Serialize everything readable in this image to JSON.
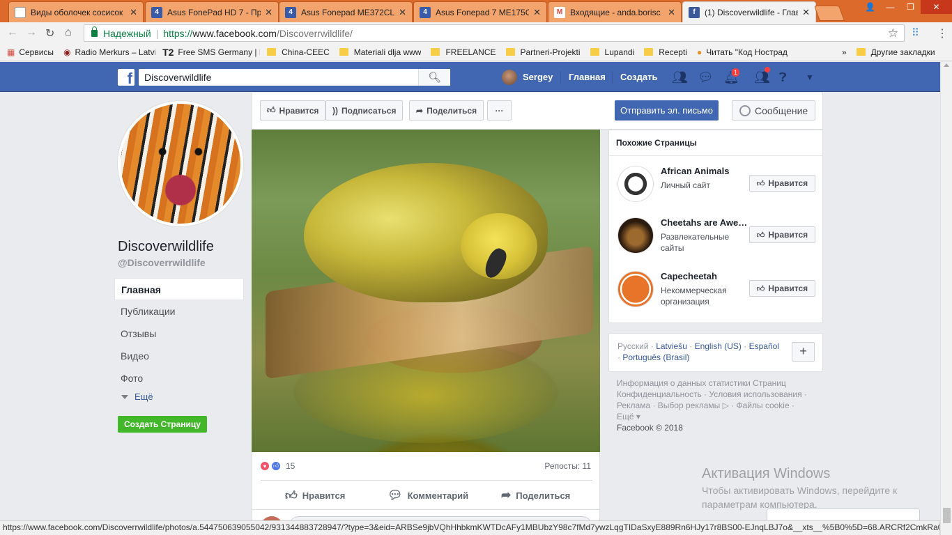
{
  "browser": {
    "tabs": [
      {
        "label": "Виды оболочек сосисок",
        "fav": "doc"
      },
      {
        "label": "Asus FonePad HD 7 - Пр",
        "fav": "4pda"
      },
      {
        "label": "Asus Fonepad ME372CL",
        "fav": "4pda"
      },
      {
        "label": "Asus Fonepad 7 ME175C",
        "fav": "4pda"
      },
      {
        "label": "Входящие - anda.borisc",
        "fav": "gmail"
      },
      {
        "label": "(1) Discoverwildlife - Глав",
        "fav": "facebook"
      }
    ],
    "secure_label": "Надежный",
    "url_proto": "https://",
    "url_host": "www.facebook.com",
    "url_path": "/Discoverrwildlife/",
    "bookmarks": [
      {
        "label": "Сервисы",
        "icon": "apps-icon"
      },
      {
        "label": "Radio Merkurs – Latvi",
        "icon": "radio-icon"
      },
      {
        "label": "Free SMS Germany | F",
        "icon": "t2-icon"
      },
      {
        "label": "China-CEEC",
        "icon": "folder-icon"
      },
      {
        "label": "Materiali dlja www",
        "icon": "folder-icon"
      },
      {
        "label": "FREELANCE",
        "icon": "folder-icon"
      },
      {
        "label": "Partneri-Projekti",
        "icon": "folder-icon"
      },
      {
        "label": "Lupandi",
        "icon": "folder-icon"
      },
      {
        "label": "Recepti",
        "icon": "folder-icon"
      },
      {
        "label": "Читать \"Код Нострад",
        "icon": "book-icon"
      }
    ],
    "bookmarks_more": "»",
    "other_bookmarks": "Другие закладки",
    "status_url": "https://www.facebook.com/Discoverrwildlife/photos/a.544750639055042/931344883728947/?type=3&eid=ARBSe9jbVQhHhbkmKWTDcAFy1MBUbzY98c7fMd7ywzLqgTIDaSxyE889Rn6HJy17r8BS00-EJnqLBJ7o&__xts__%5B0%5D=68.ARCRf2CmkRa0rpUI..."
  },
  "fb_header": {
    "search_value": "Discoverwildlife",
    "user_name": "Sergey",
    "home_label": "Главная",
    "create_label": "Создать",
    "notification_count": "1"
  },
  "page": {
    "name": "Discoverwildlife",
    "handle": "@Discoverrwildlife",
    "nav": [
      "Главная",
      "Публикации",
      "Отзывы",
      "Видео",
      "Фото"
    ],
    "more_label": "Ещё",
    "create_page_label": "Создать Страницу"
  },
  "actions": {
    "like": "Нравится",
    "follow": "Подписаться",
    "share": "Поделиться",
    "more": "···",
    "email": "Отправить эл. письмо",
    "message": "Сообщение"
  },
  "post": {
    "reactions_count": "15",
    "reposts": "Репосты: 11",
    "like": "Нравится",
    "comment": "Комментарий",
    "share": "Поделиться"
  },
  "similar": {
    "title": "Похожие Страницы",
    "like_label": "Нравится",
    "items": [
      {
        "name": "African Animals",
        "category": "Личный сайт"
      },
      {
        "name": "Cheetahs are Awe…",
        "category": "Развлекательные сайты"
      },
      {
        "name": "Capecheetah",
        "category": "Некоммерческая организация"
      }
    ]
  },
  "languages": {
    "current": "Русский",
    "sep": " · ",
    "list": [
      "Latviešu",
      "English (US)",
      "Español",
      "Português (Brasil)"
    ],
    "plus": "+"
  },
  "footer": {
    "line1": "Информация о данных статистики Страниц",
    "line2": "Конфиденциальность · Условия использования ·",
    "line3": "Реклама · Выбор рекламы ▷ · Файлы cookie ·",
    "line4": "Ещё ▾",
    "copyright": "Facebook © 2018"
  },
  "windows_activation": {
    "title": "Активация Windows",
    "subtitle_1": "Чтобы активировать Windows, перейдите к",
    "subtitle_2": "параметрам компьютера."
  },
  "colors": {
    "fb_blue": "#4267b2",
    "tabstrip": "#dc6a2a",
    "create_green": "#42b72a"
  }
}
